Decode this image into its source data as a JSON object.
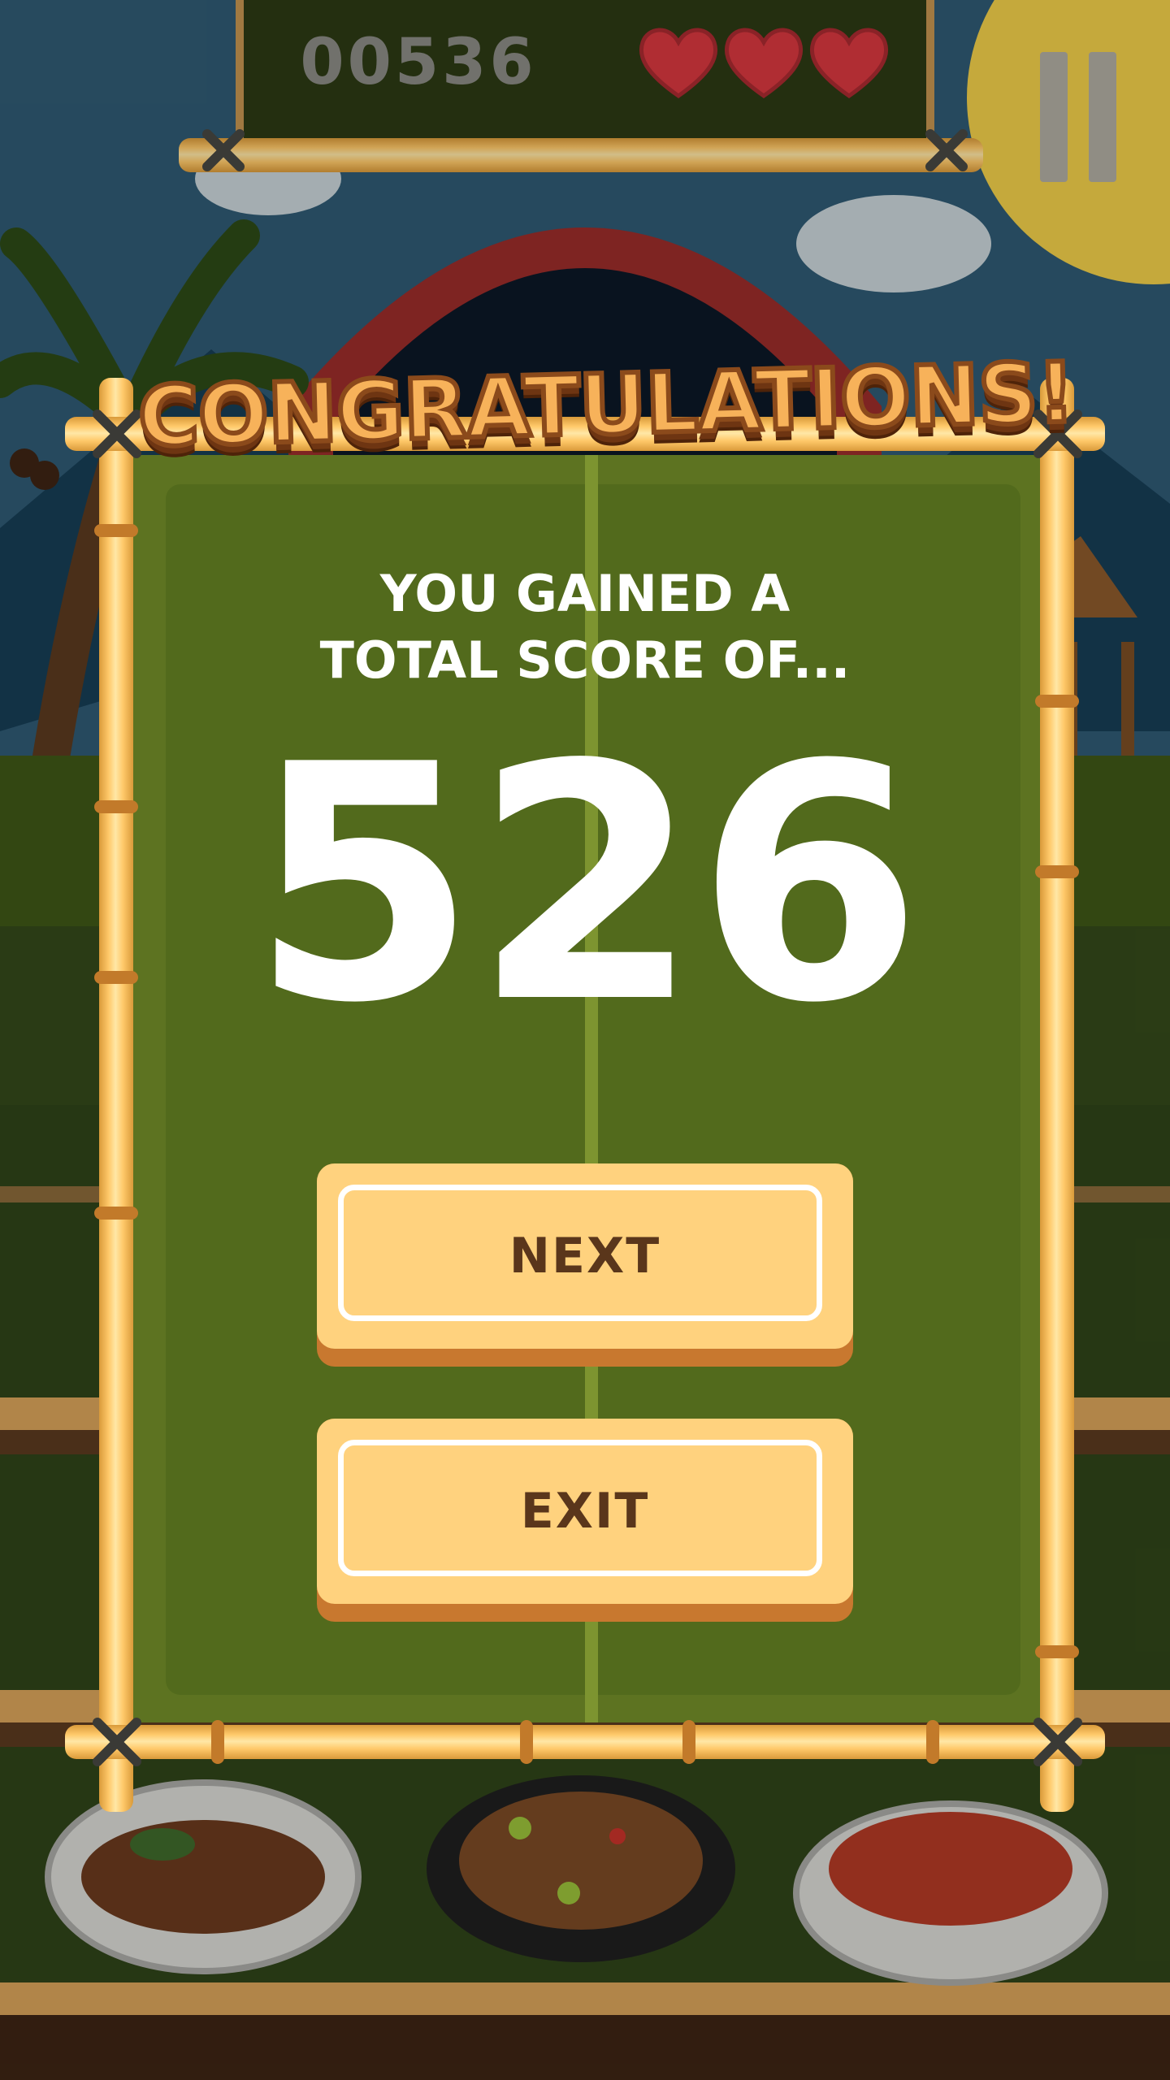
{
  "hud": {
    "score": "00536",
    "lives": 3,
    "max_lives": 3
  },
  "dialog": {
    "title": "CONGRATULATIONS!",
    "subtitle_line1": "YOU GAINED A",
    "subtitle_line2": "TOTAL SCORE OF...",
    "total_score": "526",
    "next_label": "NEXT",
    "exit_label": "EXIT"
  },
  "colors": {
    "heart": "#d7383f",
    "button_face": "#ffd27e",
    "button_text": "#5a361b",
    "panel": "#5d7321",
    "bamboo": "#ffc96a"
  }
}
